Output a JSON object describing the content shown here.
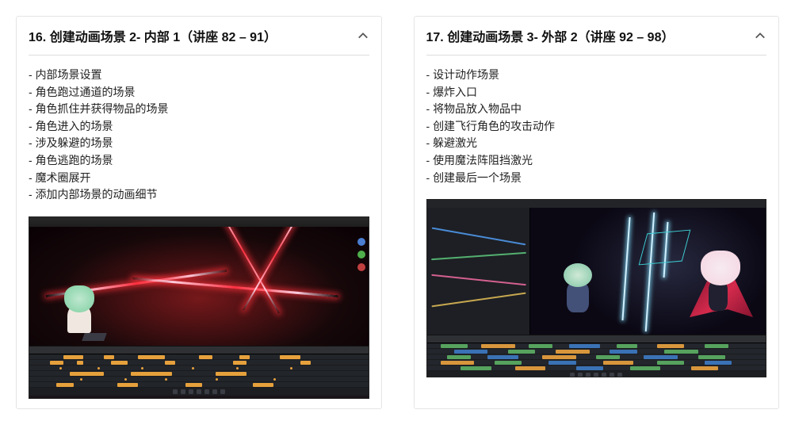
{
  "card1": {
    "title": "16. 创建动画场景 2- 内部 1（讲座 82 – 91）",
    "items": [
      "内部场景设置",
      "角色跑过通道的场景",
      "角色抓住并获得物品的场景",
      "角色进入的场景",
      "涉及躲避的场景",
      "角色逃跑的场景",
      "魔术圈展开",
      "添加内部场景的动画细节"
    ]
  },
  "card2": {
    "title": "17. 创建动画场景 3- 外部 2（讲座 92 – 98）",
    "items": [
      "设计动作场景",
      "爆炸入口",
      "将物品放入物品中",
      "创建飞行角色的攻击动作",
      "躲避激光",
      "使用魔法阵阻挡激光",
      "创建最后一个场景"
    ]
  }
}
